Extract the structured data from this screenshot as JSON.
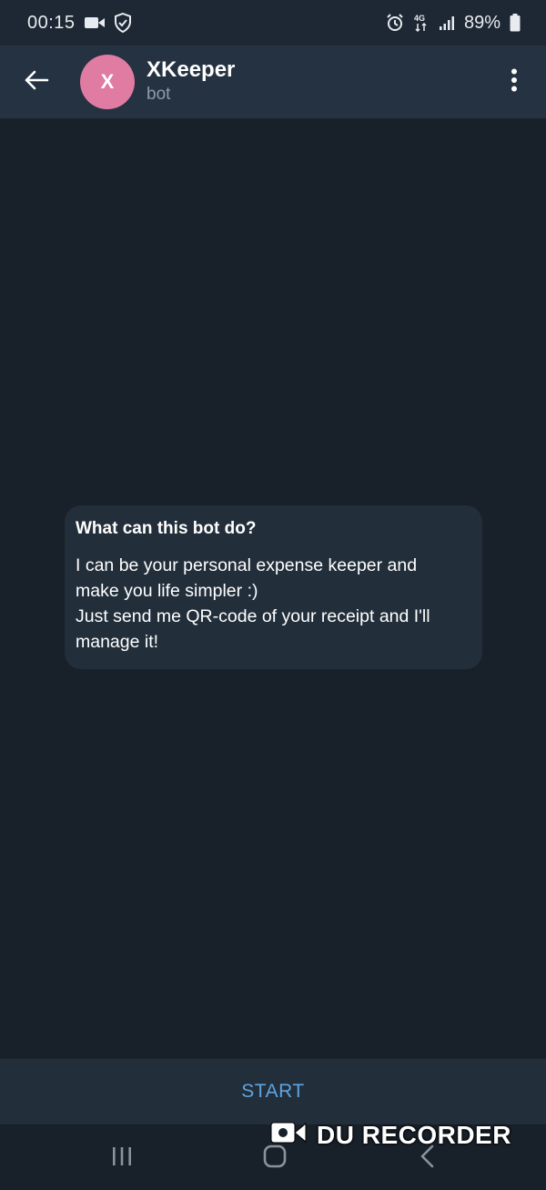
{
  "status_bar": {
    "time": "00:15",
    "network": "4G",
    "battery": "89%",
    "icons": [
      "video-icon",
      "shield-icon",
      "alarm-icon",
      "network-4g-icon",
      "signal-icon",
      "battery-icon"
    ]
  },
  "header": {
    "avatar_letter": "X",
    "avatar_color": "#e07ba2",
    "title": "XKeeper",
    "subtitle": "bot"
  },
  "info_card": {
    "title": "What can this bot do?",
    "lines": [
      "I can be your personal expense keeper and",
      "make you life simpler :)",
      "Just send me QR-code of your receipt and I'll",
      "manage it!"
    ]
  },
  "start_button": {
    "label": "START",
    "color": "#5ea4e0"
  },
  "watermark": {
    "text": "DU RECORDER"
  },
  "nav_bar": {
    "icons": [
      "recent-apps-icon",
      "home-icon",
      "back-nav-icon"
    ]
  }
}
